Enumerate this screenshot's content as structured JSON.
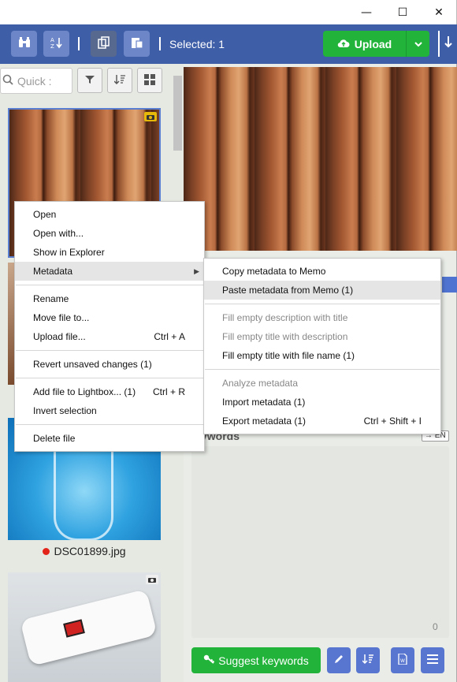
{
  "window": {
    "controls": {
      "minimize": "—",
      "maximize": "☐",
      "close": "✕"
    }
  },
  "toolbar": {
    "selected_label": "Selected: 1",
    "upload_label": "Upload",
    "icons": [
      "binoculars-icon",
      "sort-az-icon",
      "copy-icon",
      "paste-icon",
      "cloud-upload-icon",
      "chevron-down-icon",
      "download-arrow-icon"
    ]
  },
  "left": {
    "search_placeholder": "Quick :",
    "files": [
      {
        "name": "DSC01899.jpg",
        "status_color": "#e3241b"
      }
    ]
  },
  "right": {
    "keywords_title": "ywords",
    "lang_tag": "→ EN",
    "keywords_count": "0",
    "suggest_label": "Suggest keywords"
  },
  "context_menu": {
    "items": [
      {
        "label": "Open"
      },
      {
        "label": "Open with..."
      },
      {
        "label": "Show in Explorer"
      },
      {
        "label": "Metadata",
        "submenu": true
      },
      {
        "label": "Rename"
      },
      {
        "label": "Move file to..."
      },
      {
        "label": "Upload file...",
        "shortcut": "Ctrl + A"
      },
      {
        "label": "Revert unsaved changes (1)"
      },
      {
        "label": "Add file to Lightbox... (1)",
        "shortcut": "Ctrl + R"
      },
      {
        "label": "Invert selection"
      },
      {
        "label": "Delete file"
      }
    ]
  },
  "metadata_submenu": {
    "items": [
      {
        "label": "Copy metadata to Memo"
      },
      {
        "label": "Paste metadata from Memo (1)"
      },
      {
        "label": "Fill empty description with title"
      },
      {
        "label": "Fill empty title with description"
      },
      {
        "label": "Fill empty title with file name (1)"
      },
      {
        "label": "Analyze metadata"
      },
      {
        "label": "Import metadata (1)"
      },
      {
        "label": "Export metadata (1)",
        "shortcut": "Ctrl + Shift + I"
      }
    ]
  },
  "colors": {
    "toolbar": "#3f5ea8",
    "green": "#22b33a",
    "accent_blue": "#5876cf"
  }
}
